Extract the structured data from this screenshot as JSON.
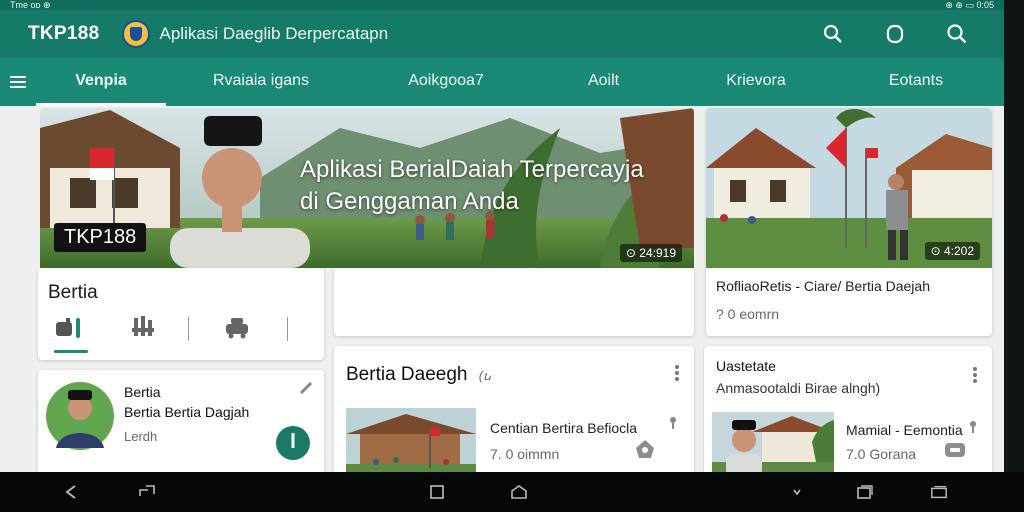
{
  "status": {
    "left": "Tme ᴏᴅ ⊕",
    "right": "⊕ ⊕ ▭ 0:05"
  },
  "app": {
    "brand": "TKP188",
    "title": "Aplikasi Daeglib Derpercatapn"
  },
  "tabs": [
    {
      "label": "Venpia",
      "active": true
    },
    {
      "label": "Rvaiaia igans"
    },
    {
      "label": "Aoikgooa7"
    },
    {
      "label": "Aoilt"
    },
    {
      "label": "Krievora"
    },
    {
      "label": "Eotants"
    }
  ],
  "hero": {
    "title_l1": "Aplikasi BerialDaiah Terpercayja",
    "title_l2": "di Genggaman Anda",
    "badge": "TKP188",
    "stat": "⊙ 24:919"
  },
  "side_hero": {
    "stat": "⊙ 4:202",
    "caption": "RofliaoRetis - Ciare/ Bertia Daejah",
    "meta": "? 0 eomrn"
  },
  "berita_card": {
    "title": "Bertia"
  },
  "profile_card": {
    "name": "Bertia",
    "subtitle": "Bertia Bertia Dagjah",
    "meta": "Lerdh",
    "fab": "ꟾ"
  },
  "daerah_card": {
    "title": "Bertia Daeegh",
    "title_suffix": "(ꭎ",
    "item_title": "Centian Bertira Befiocla",
    "item_meta": "7. 0 oimmn"
  },
  "right_card": {
    "title": "Uastetate",
    "subtitle": "Anmasootaldi Birae alngh)",
    "item_title": "Mamial - Eemontia",
    "item_meta": "7.0 Gorana"
  }
}
